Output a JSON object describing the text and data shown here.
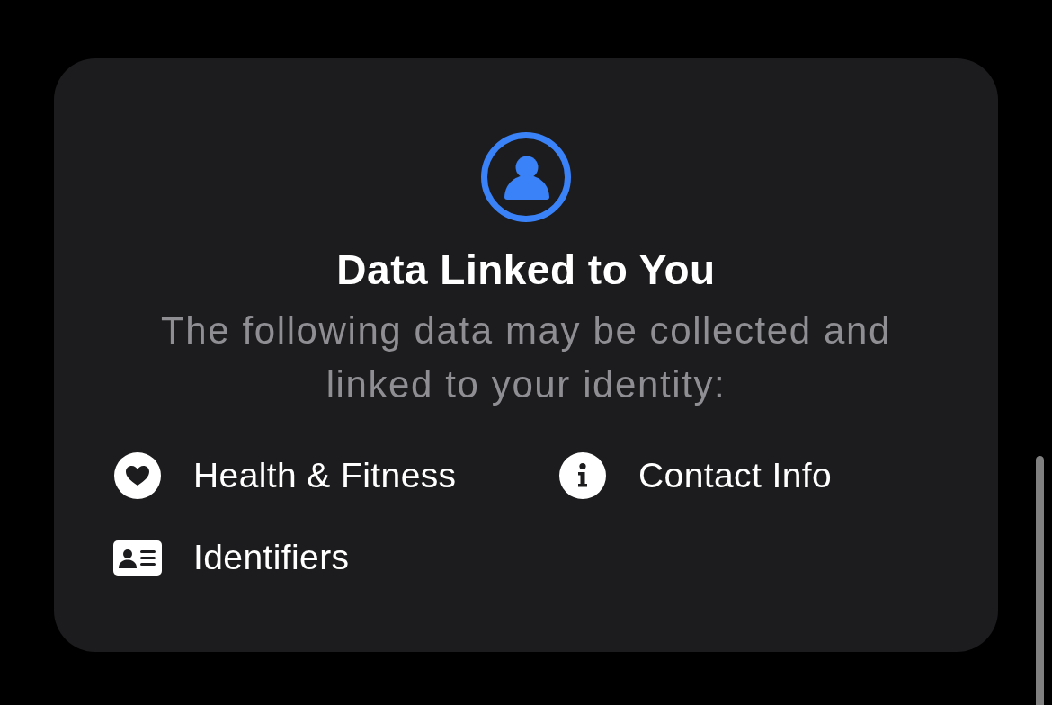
{
  "card": {
    "title": "Data Linked to You",
    "subtitle": "The following data may be collected and linked to your identity:",
    "items": [
      {
        "kind": "health",
        "label": "Health & Fitness"
      },
      {
        "kind": "contact",
        "label": "Contact Info"
      },
      {
        "kind": "identifiers",
        "label": "Identifiers"
      }
    ]
  }
}
